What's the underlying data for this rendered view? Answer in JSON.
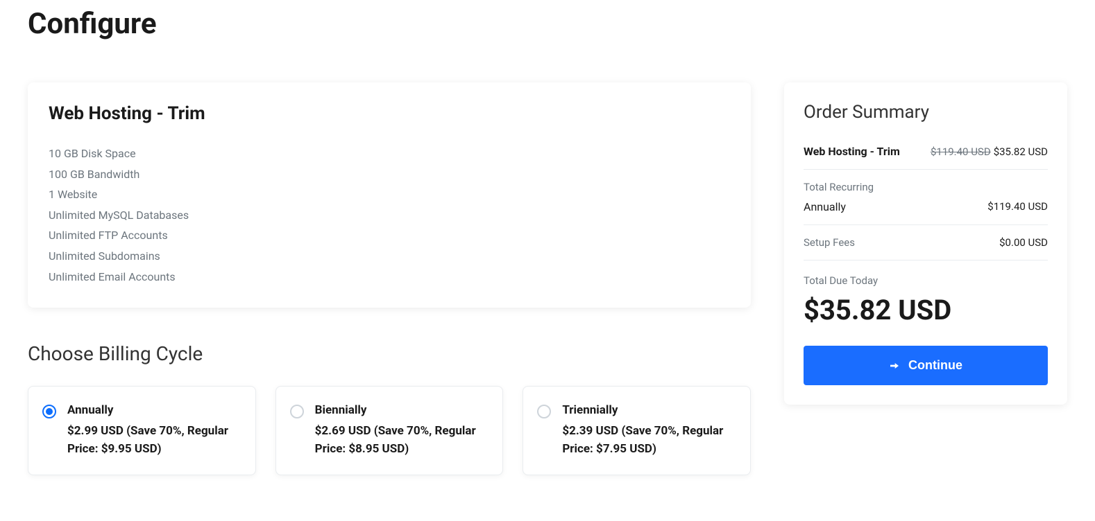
{
  "page": {
    "title": "Configure"
  },
  "product": {
    "name": "Web Hosting - Trim",
    "features": [
      "10 GB Disk Space",
      "100 GB Bandwidth",
      "1 Website",
      "Unlimited MySQL Databases",
      "Unlimited FTP Accounts",
      "Unlimited Subdomains",
      "Unlimited Email Accounts"
    ]
  },
  "billing": {
    "section_title": "Choose Billing Cycle",
    "options": [
      {
        "name": "Annually",
        "price_line": "$2.99 USD (Save 70%, Regular Price: $9.95 USD)",
        "selected": true
      },
      {
        "name": "Biennially",
        "price_line": "$2.69 USD (Save 70%, Regular Price: $8.95 USD)",
        "selected": false
      },
      {
        "name": "Triennially",
        "price_line": "$2.39 USD (Save 70%, Regular Price: $7.95 USD)",
        "selected": false
      }
    ]
  },
  "summary": {
    "title": "Order Summary",
    "item": {
      "name": "Web Hosting - Trim",
      "original_price": "$119.40 USD",
      "price": "$35.82 USD"
    },
    "recurring": {
      "label": "Total Recurring",
      "period": "Annually",
      "amount": "$119.40 USD"
    },
    "setup": {
      "label": "Setup Fees",
      "amount": "$0.00 USD"
    },
    "total": {
      "label": "Total Due Today",
      "amount": "$35.82 USD"
    },
    "continue_label": "Continue"
  }
}
